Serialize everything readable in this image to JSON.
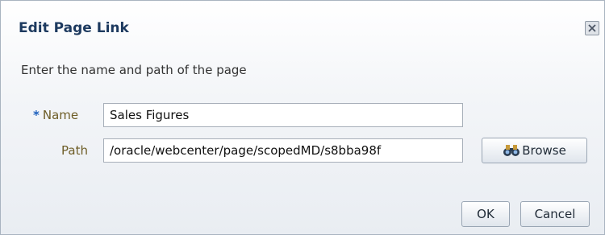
{
  "dialog": {
    "title": "Edit Page Link",
    "instructions": "Enter the name and path of the page",
    "close_icon": "close-icon"
  },
  "form": {
    "name_required_marker": "*",
    "name_label": "Name",
    "name_value": "Sales Figures",
    "path_label": "Path",
    "path_value": "/oracle/webcenter/page/scopedMD/s8bba98f"
  },
  "buttons": {
    "browse_label": "Browse",
    "browse_icon": "binoculars-icon",
    "ok_label": "OK",
    "cancel_label": "Cancel"
  }
}
